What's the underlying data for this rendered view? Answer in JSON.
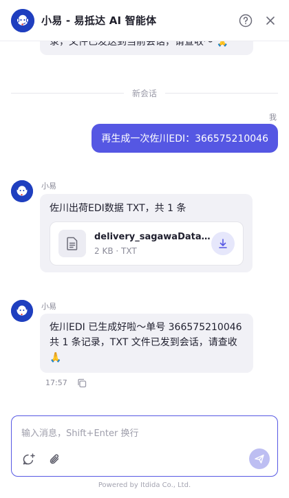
{
  "header": {
    "title": "小易 - 易抵达 AI 智能体",
    "help_icon": "help-circle-icon",
    "close_icon": "close-icon"
  },
  "chat": {
    "prev_partial_text": "录，文件已发送到当前会话，请查收～",
    "prev_partial_emoji": "🙏",
    "divider_label": "新会话",
    "user_label": "我",
    "user_message": "再生成一次佐川EDI：366575210046",
    "bot_name": "小易",
    "bot_message_1": "佐川出荷EDI数据 TXT，共 1 条",
    "file": {
      "name": "delivery_sagawaData...",
      "meta": "2 KB · TXT",
      "icon": "document-icon",
      "download_icon": "download-icon"
    },
    "bot_message_2": "佐川EDI 已生成好啦～单号 366575210046 共 1 条记录，TXT 文件已发到会话，请查收",
    "bot_message_2_emoji": "🙏",
    "time": "17:57",
    "copy_icon": "copy-icon"
  },
  "composer": {
    "placeholder": "输入消息，Shift+Enter 换行",
    "value": "",
    "new_chat_icon": "new-chat-icon",
    "attach_icon": "paperclip-icon",
    "send_icon": "send-icon"
  },
  "footer": {
    "text": "Powered by Itdida Co., Ltd."
  },
  "colors": {
    "accent": "#5557e3",
    "avatar": "#1f3fbf",
    "bot_bubble": "#f1f1f6"
  }
}
